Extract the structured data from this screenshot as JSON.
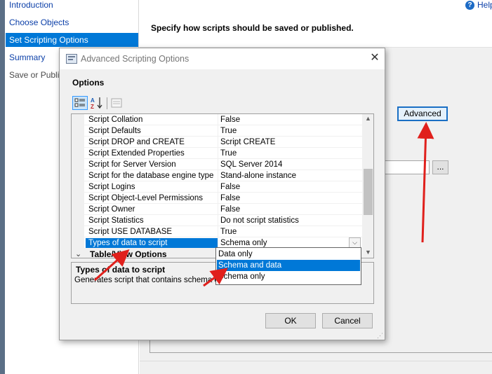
{
  "wizard": {
    "nav_items": [
      {
        "label": "Introduction",
        "state": "link"
      },
      {
        "label": "Choose Objects",
        "state": "link"
      },
      {
        "label": "Set Scripting Options",
        "state": "selected"
      },
      {
        "label": "Summary",
        "state": "link"
      },
      {
        "label": "Save or Publish",
        "state": "disabled"
      }
    ],
    "heading": "Specify how scripts should be saved or published.",
    "help_label": "Help",
    "advanced_button": "Advanced",
    "browse_button": "..."
  },
  "dialog": {
    "title": "Advanced Scripting Options",
    "options_label": "Options",
    "properties": [
      {
        "name": "Script Collation",
        "value": "False"
      },
      {
        "name": "Script Defaults",
        "value": "True"
      },
      {
        "name": "Script DROP and CREATE",
        "value": "Script CREATE"
      },
      {
        "name": "Script Extended Properties",
        "value": "True"
      },
      {
        "name": "Script for Server Version",
        "value": "SQL Server 2014"
      },
      {
        "name": "Script for the database engine type",
        "value": "Stand-alone instance"
      },
      {
        "name": "Script Logins",
        "value": "False"
      },
      {
        "name": "Script Object-Level Permissions",
        "value": "False"
      },
      {
        "name": "Script Owner",
        "value": "False"
      },
      {
        "name": "Script Statistics",
        "value": "Do not script statistics"
      },
      {
        "name": "Script USE DATABASE",
        "value": "True"
      },
      {
        "name": "Types of data to script",
        "value": "Schema only"
      }
    ],
    "category": "Table/View Options",
    "dropdown_options": [
      "Data only",
      "Schema and data",
      "Schema only"
    ],
    "dropdown_highlighted": "Schema and data",
    "description_title": "Types of data to script",
    "description_text": "Generates script that contains schema only",
    "ok_button": "OK",
    "cancel_button": "Cancel"
  },
  "colors": {
    "selection": "#0078d7",
    "annotation_arrow": "#e0201c",
    "advanced_border": "#1a6fc4"
  },
  "icons": [
    "help-icon",
    "dialog-app-icon",
    "close-icon",
    "categorized-icon",
    "sort-alphabetical-icon",
    "property-pages-icon",
    "chevron-down-icon",
    "scroll-up-icon",
    "scroll-down-icon",
    "dropdown-arrow-icon",
    "resize-grip-icon"
  ]
}
